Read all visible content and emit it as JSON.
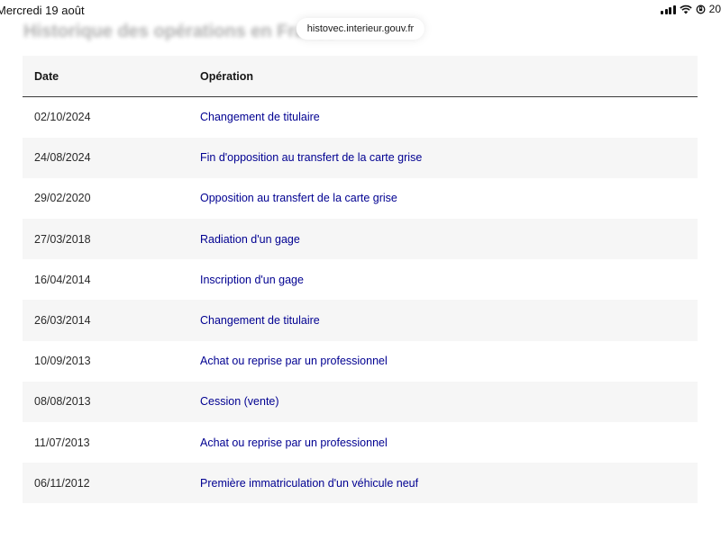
{
  "status_bar": {
    "time": "Mercredi 19 août",
    "battery": "20"
  },
  "browser": {
    "url": "histovec.interieur.gouv.fr"
  },
  "page": {
    "heading": "Historique des opérations en France"
  },
  "table": {
    "headers": {
      "date": "Date",
      "operation": "Opération"
    },
    "rows": [
      {
        "date": "02/10/2024",
        "operation": "Changement de titulaire"
      },
      {
        "date": "24/08/2024",
        "operation": "Fin d'opposition au transfert de la carte grise"
      },
      {
        "date": "29/02/2020",
        "operation": "Opposition au transfert de la carte grise"
      },
      {
        "date": "27/03/2018",
        "operation": "Radiation d'un gage"
      },
      {
        "date": "16/04/2014",
        "operation": "Inscription d'un gage"
      },
      {
        "date": "26/03/2014",
        "operation": "Changement de titulaire"
      },
      {
        "date": "10/09/2013",
        "operation": "Achat ou reprise par un professionnel"
      },
      {
        "date": "08/08/2013",
        "operation": "Cession (vente)"
      },
      {
        "date": "11/07/2013",
        "operation": "Achat ou reprise par un professionnel"
      },
      {
        "date": "06/11/2012",
        "operation": "Première immatriculation d'un véhicule neuf"
      }
    ]
  },
  "colors": {
    "link": "#000091",
    "row_alt": "#f6f6f6",
    "header_rule": "#3a3a3a"
  }
}
